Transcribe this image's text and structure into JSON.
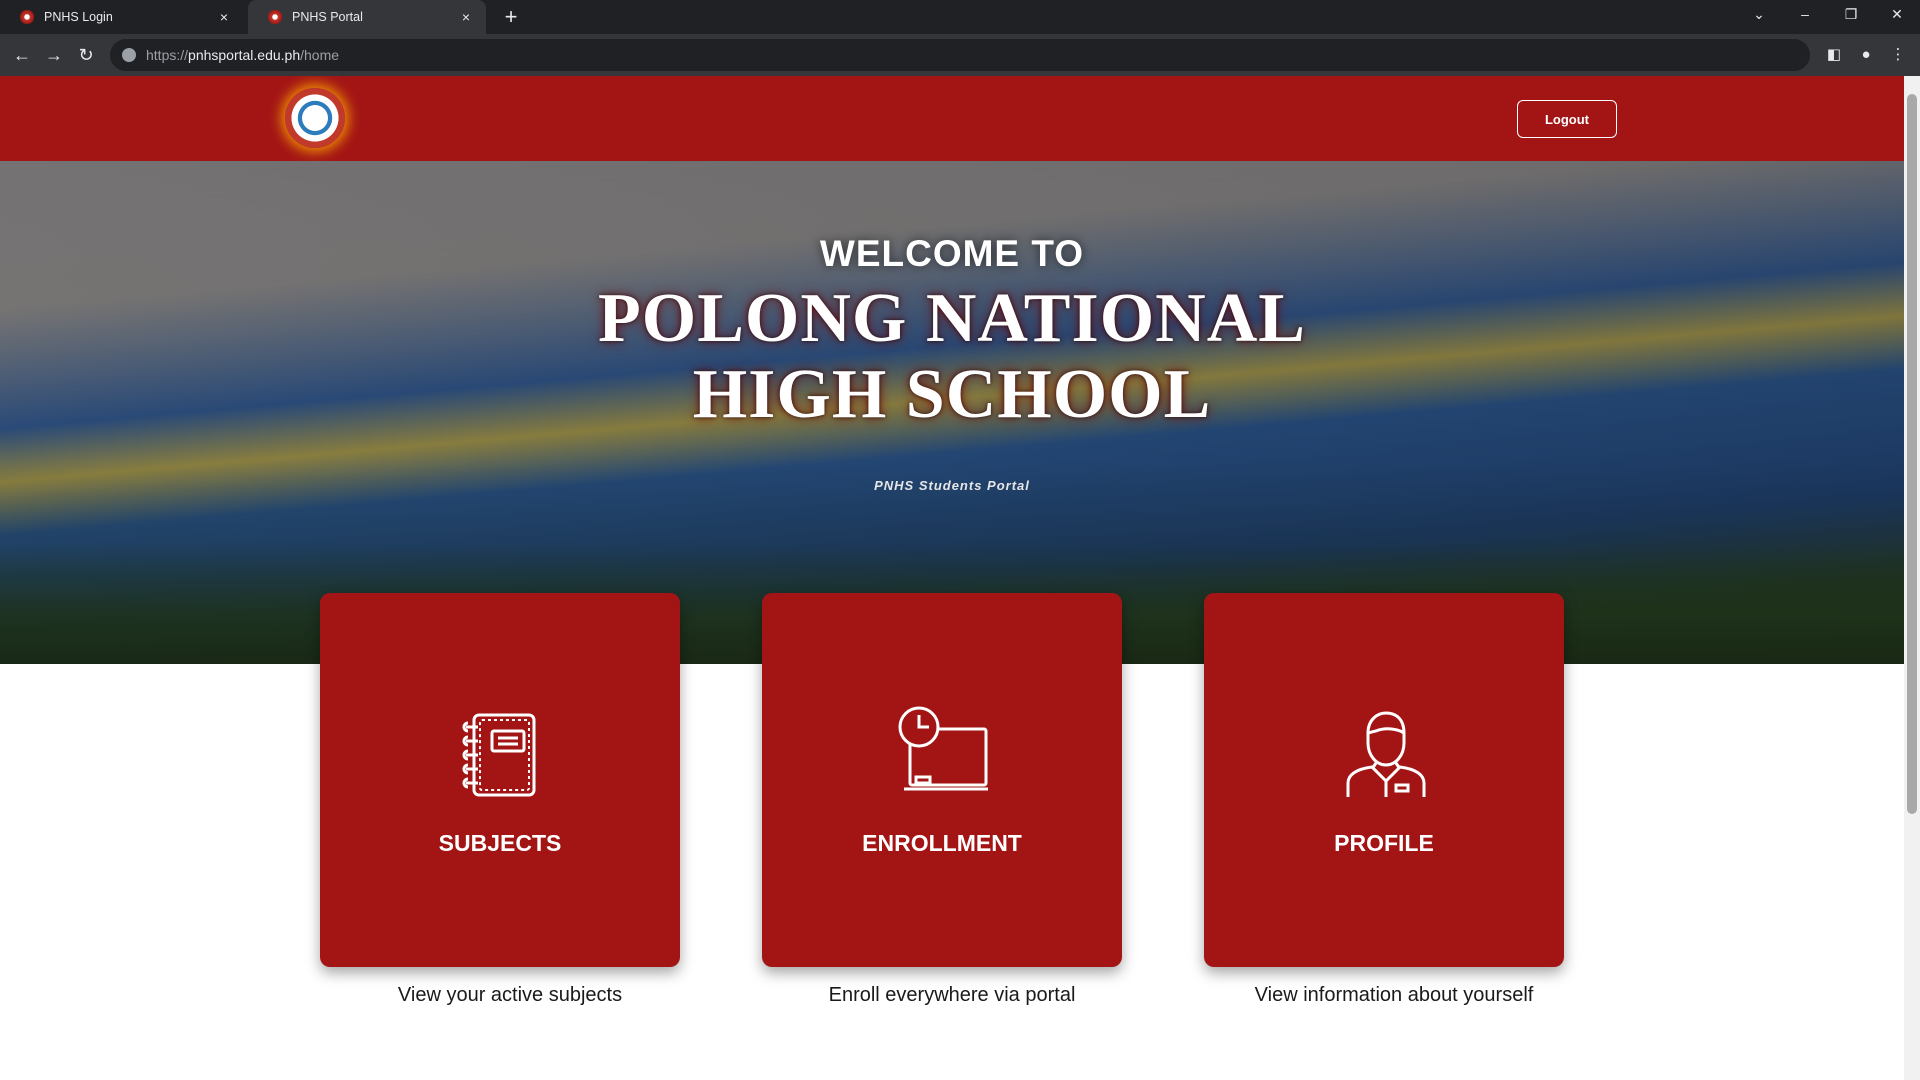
{
  "browser": {
    "tabs": [
      {
        "title": "PNHS Login",
        "close": "×"
      },
      {
        "title": "PNHS Portal",
        "close": "×"
      }
    ],
    "new_tab": "+",
    "url_prefix": "https://",
    "url_host": "pnhsportal.edu.ph",
    "url_path": "/home"
  },
  "header": {
    "logout_label": "Logout"
  },
  "hero": {
    "welcome": "WELCOME TO",
    "school_line1": "POLONG NATIONAL",
    "school_line2": "HIGH SCHOOL",
    "tagline": "PNHS Students Portal"
  },
  "cards": [
    {
      "title": "SUBJECTS",
      "description": "View your active subjects",
      "icon": "notebook-icon"
    },
    {
      "title": "ENROLLMENT",
      "description": "Enroll everywhere via portal",
      "icon": "classroom-clock-icon"
    },
    {
      "title": "PROFILE",
      "description": "View information about yourself",
      "icon": "student-icon"
    }
  ],
  "colors": {
    "brand_red": "#a31515",
    "chrome_dark": "#202124",
    "chrome_toolbar": "#35363a"
  }
}
